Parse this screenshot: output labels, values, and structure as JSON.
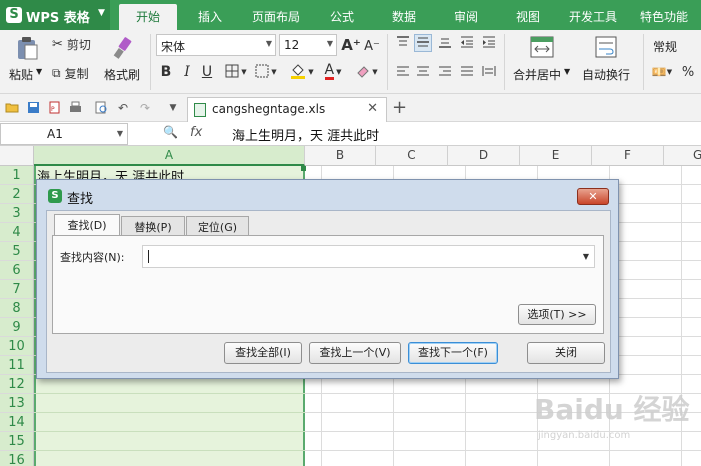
{
  "app": {
    "name": "WPS 表格",
    "logo": "S"
  },
  "menu": {
    "tabs": [
      "开始",
      "插入",
      "页面布局",
      "公式",
      "数据",
      "审阅",
      "视图",
      "开发工具",
      "特色功能"
    ],
    "active_index": 0
  },
  "ribbon": {
    "paste": "粘贴",
    "cut": "剪切",
    "copy": "复制",
    "format_painter": "格式刷",
    "font_name": "宋体",
    "font_size": "12",
    "bold": "B",
    "italic": "I",
    "underline": "U",
    "merge_center": "合并居中",
    "wrap_text": "自动换行",
    "number_format": "常规",
    "percent": "%"
  },
  "document": {
    "tab_name": "cangshegntage.xls"
  },
  "formula_bar": {
    "cell_ref": "A1",
    "fx": "fx",
    "content": "海上生明月，天  涯共此时"
  },
  "grid": {
    "columns": [
      "A",
      "B",
      "C",
      "D",
      "E",
      "F",
      "G"
    ],
    "rows": [
      "1",
      "2",
      "3",
      "4",
      "5",
      "6",
      "7",
      "8",
      "9",
      "10",
      "11",
      "12",
      "13",
      "14",
      "15",
      "16"
    ],
    "selected_column": "A",
    "cell_a1": "海上生明月，天  涯共此时"
  },
  "dialog": {
    "title": "查找",
    "tabs": [
      "查找(D)",
      "替换(P)",
      "定位(G)"
    ],
    "active_tab": 0,
    "find_label": "查找内容(N):",
    "find_value": "",
    "options_button": "选项(T) >>",
    "buttons": {
      "find_all": "查找全部(I)",
      "find_prev": "查找上一个(V)",
      "find_next": "查找下一个(F)",
      "close": "关闭"
    }
  },
  "watermark": {
    "logo": "Baidu 经验",
    "url": "jingyan.baidu.com"
  },
  "colors": {
    "brand_green": "#3a9e57",
    "selection_fill": "#e6f3dc",
    "dialog_frame": "#cfdcec"
  }
}
